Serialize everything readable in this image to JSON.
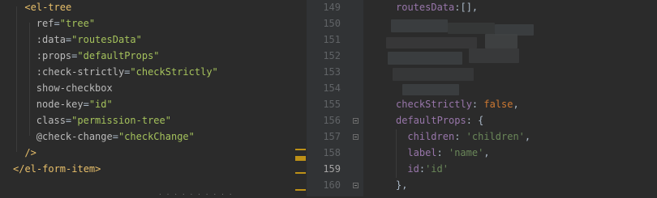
{
  "left_code": [
    {
      "indent": 2,
      "tokens": [
        {
          "c": "tag",
          "t": "<el-tree"
        }
      ]
    },
    {
      "indent": 4,
      "tokens": [
        {
          "c": "attr",
          "t": "ref"
        },
        {
          "c": "eq",
          "t": "="
        },
        {
          "c": "str",
          "t": "\"tree\""
        }
      ]
    },
    {
      "indent": 4,
      "tokens": [
        {
          "c": "attr",
          "t": ":data"
        },
        {
          "c": "eq",
          "t": "="
        },
        {
          "c": "str",
          "t": "\"routesData\""
        }
      ]
    },
    {
      "indent": 4,
      "tokens": [
        {
          "c": "attr",
          "t": ":props"
        },
        {
          "c": "eq",
          "t": "="
        },
        {
          "c": "str",
          "t": "\"defaultProps\""
        }
      ]
    },
    {
      "indent": 4,
      "tokens": [
        {
          "c": "attr",
          "t": ":check-strictly"
        },
        {
          "c": "eq",
          "t": "="
        },
        {
          "c": "str",
          "t": "\"checkStrictly\""
        }
      ]
    },
    {
      "indent": 4,
      "tokens": [
        {
          "c": "attr",
          "t": "show-checkbox"
        }
      ]
    },
    {
      "indent": 4,
      "tokens": [
        {
          "c": "attr",
          "t": "node-key"
        },
        {
          "c": "eq",
          "t": "="
        },
        {
          "c": "str",
          "t": "\"id\""
        }
      ]
    },
    {
      "indent": 4,
      "tokens": [
        {
          "c": "attr",
          "t": "class"
        },
        {
          "c": "eq",
          "t": "="
        },
        {
          "c": "str",
          "t": "\"permission-tree\""
        }
      ]
    },
    {
      "indent": 4,
      "tokens": [
        {
          "c": "attr",
          "t": "@check-change"
        },
        {
          "c": "eq",
          "t": "="
        },
        {
          "c": "str",
          "t": "\"checkChange\""
        }
      ]
    },
    {
      "indent": 2,
      "tokens": [
        {
          "c": "tag",
          "t": "/>"
        }
      ]
    },
    {
      "indent": 0,
      "tokens": [
        {
          "c": "tag",
          "t": "</el-form-item>"
        }
      ]
    }
  ],
  "line_numbers": [
    "149",
    "150",
    "151",
    "152",
    "153",
    "154",
    "155",
    "156",
    "157",
    "158",
    "159",
    "160"
  ],
  "current_line": "159",
  "right_code": [
    {
      "indent": 0,
      "tokens": [
        {
          "c": "key",
          "t": "routesData"
        },
        {
          "c": "plain",
          "t": ":[],"
        }
      ]
    },
    {
      "indent": 0,
      "tokens": []
    },
    {
      "indent": 0,
      "tokens": []
    },
    {
      "indent": 0,
      "tokens": []
    },
    {
      "indent": 0,
      "tokens": []
    },
    {
      "indent": 0,
      "tokens": []
    },
    {
      "indent": 0,
      "tokens": [
        {
          "c": "key",
          "t": "checkStrictly"
        },
        {
          "c": "plain",
          "t": ": "
        },
        {
          "c": "kw",
          "t": "false"
        },
        {
          "c": "plain",
          "t": ","
        }
      ]
    },
    {
      "indent": 0,
      "tokens": [
        {
          "c": "key",
          "t": "defaultProps"
        },
        {
          "c": "plain",
          "t": ": {"
        }
      ]
    },
    {
      "indent": 2,
      "tokens": [
        {
          "c": "key",
          "t": "children"
        },
        {
          "c": "plain",
          "t": ": "
        },
        {
          "c": "strb",
          "t": "'children'"
        },
        {
          "c": "plain",
          "t": ","
        }
      ]
    },
    {
      "indent": 2,
      "tokens": [
        {
          "c": "key",
          "t": "label"
        },
        {
          "c": "plain",
          "t": ": "
        },
        {
          "c": "strb",
          "t": "'name'"
        },
        {
          "c": "plain",
          "t": ","
        }
      ]
    },
    {
      "indent": 2,
      "tokens": [
        {
          "c": "key",
          "t": "id"
        },
        {
          "c": "plain",
          "t": ":"
        },
        {
          "c": "strb",
          "t": "'id'"
        }
      ]
    },
    {
      "indent": 0,
      "tokens": [
        {
          "c": "plain",
          "t": "},"
        }
      ]
    }
  ],
  "colors": {
    "editor_bg": "#2b2b2b",
    "gutter_bg": "#313335",
    "tag": "#e8bf6a",
    "string": "#a5c25c",
    "property": "#9876aa",
    "keyword": "#cc7832",
    "change_marker": "#be9117"
  }
}
